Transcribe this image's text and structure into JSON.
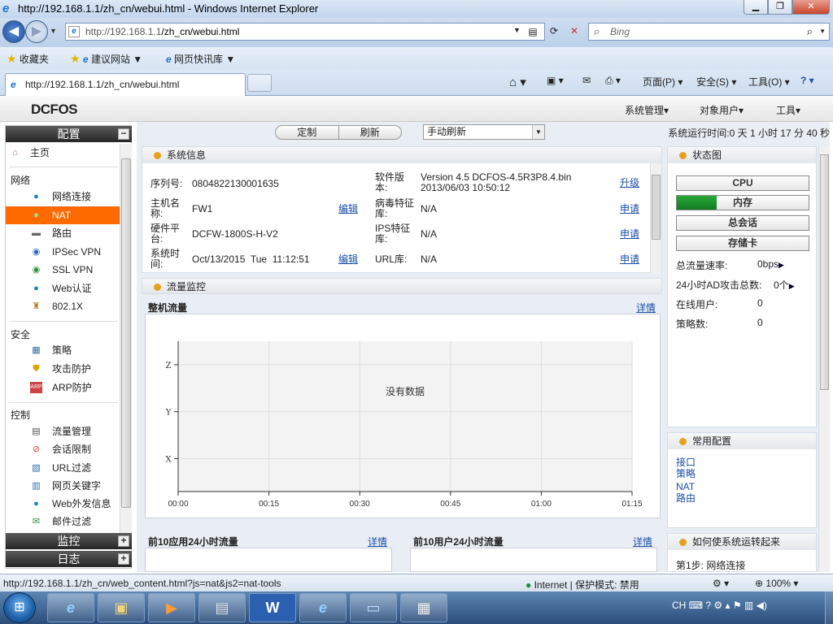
{
  "browser": {
    "title": "http://192.168.1.1/zh_cn/webui.html - Windows Internet Explorer",
    "address_prefix": "http://192.168.1.1",
    "address_path": "/zh_cn/webui.html",
    "search_placeholder": "Bing",
    "favorites": {
      "label": "收藏夹",
      "items": [
        "建议网站",
        "网页快讯库"
      ]
    },
    "tab_title": "http://192.168.1.1/zh_cn/webui.html",
    "commands": [
      "页面(P)",
      "安全(S)",
      "工具(O)"
    ],
    "status_url": "http://192.168.1.1/zh_cn/web_content.html?js=nat&js2=nat-tools",
    "zone": "Internet | 保护模式: 禁用",
    "zoom": "100%"
  },
  "app": {
    "logo": "DCFOS",
    "menus": [
      "系统管理",
      "对象用户",
      "工具"
    ],
    "toolbar": {
      "customize": "定制",
      "refresh": "刷新",
      "refresh_mode": "手动刷新"
    },
    "runtime": "系统运行时间:0 天 1 小时 17 分 40 秒"
  },
  "sidebar": {
    "header": "配置",
    "home": "主页",
    "sections": [
      {
        "title": "网络",
        "items": [
          "网络连接",
          "NAT",
          "路由",
          "IPSec VPN",
          "SSL VPN",
          "Web认证",
          "802.1X"
        ]
      },
      {
        "title": "安全",
        "items": [
          "策略",
          "攻击防护",
          "ARP防护"
        ]
      },
      {
        "title": "控制",
        "items": [
          "流量管理",
          "会话限制",
          "URL过滤",
          "网页关键字",
          "Web外发信息",
          "邮件过滤"
        ]
      }
    ],
    "footer": [
      "监控",
      "日志"
    ]
  },
  "sysinfo": {
    "title": "系统信息",
    "serial_label": "序列号:",
    "serial": "0804822130001635",
    "host_label_1": "主机名",
    "host_label_2": "称:",
    "host": "FW1",
    "host_edit": "编辑",
    "hw_label_1": "硬件平",
    "hw_label_2": "台:",
    "hw": "DCFW-1800S-H-V2",
    "time_label_1": "系统时",
    "time_label_2": "间:",
    "time": "Oct/13/2015  Tue  11:12:51",
    "time_edit": "编辑",
    "sw_label_1": "软件版",
    "sw_label_2": "本:",
    "sw_1": "Version 4.5 DCFOS-4.5R3P8.4.bin",
    "sw_2": "2013/06/03 10:50:12",
    "sw_link": "升级",
    "av_label_1": "病毒特征",
    "av_label_2": "库:",
    "av": "N/A",
    "av_link": "申请",
    "ips_label_1": "IPS特征",
    "ips_label_2": "库:",
    "ips": "N/A",
    "ips_link": "申请",
    "url_label": "URL库:",
    "url": "N/A",
    "url_link": "申请"
  },
  "flow": {
    "title": "流量监控",
    "chart_title": "整机流量",
    "detail": "详情",
    "top10_apps": "前10应用24小时流量",
    "top10_users": "前10用户24小时流量"
  },
  "chart_data": {
    "type": "line",
    "title": "整机流量",
    "message": "没有数据",
    "x_ticks": [
      "00:00",
      "00:15",
      "00:30",
      "00:45",
      "01:00",
      "01:15"
    ],
    "y_ticks": [
      "X",
      "Y",
      "Z"
    ],
    "series": [],
    "grid": true
  },
  "status": {
    "title": "状态图",
    "bars": [
      {
        "label": "CPU",
        "fill": 0.0
      },
      {
        "label": "内存",
        "fill": 0.3
      },
      {
        "label": "总会话",
        "fill": 0.0
      },
      {
        "label": "存储卡",
        "fill": 0.0
      }
    ],
    "total_rate_label": "总流量速率:",
    "total_rate": "0bps",
    "attacks_label": "24小时AD攻击总数:",
    "attacks": "0个",
    "online_label": "在线用户:",
    "online": "0",
    "policies_label": "策略数:",
    "policies": "0"
  },
  "quick": {
    "title": "常用配置",
    "links": [
      "接口",
      "策略",
      "NAT",
      "路由"
    ]
  },
  "howto": {
    "title": "如何使系统运转起来",
    "step": "第1步: 网络连接"
  },
  "taskbar": {
    "lang": "CH"
  }
}
